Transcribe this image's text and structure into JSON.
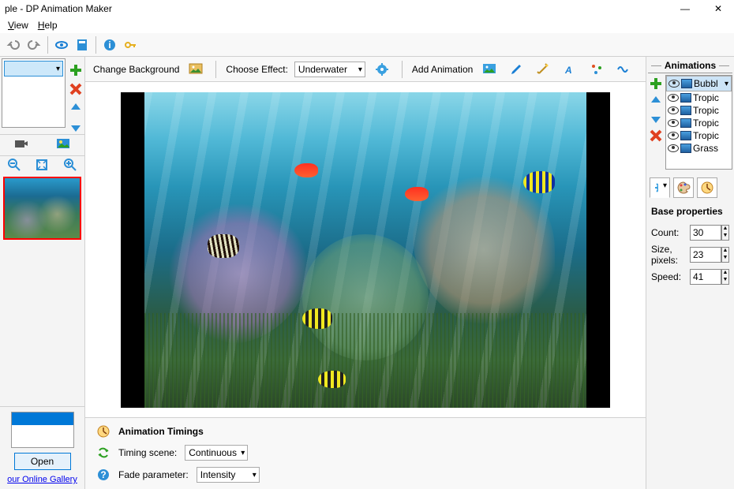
{
  "title": "ple - DP Animation Maker",
  "menu": {
    "view": "View",
    "help": "Help"
  },
  "toolbar2": {
    "change_bg": "Change Background",
    "choose_effect": "Choose Effect:",
    "effect_value": "Underwater",
    "add_animation": "Add Animation"
  },
  "left": {
    "open": "Open",
    "gallery": "our Online Gallery"
  },
  "timings": {
    "title": "Animation Timings",
    "scene_label": "Timing scene:",
    "scene_value": "Continuous",
    "fade_label": "Fade parameter:",
    "fade_value": "Intensity"
  },
  "anims": {
    "header": "Animations",
    "items": [
      {
        "label": "Bubbl"
      },
      {
        "label": "Tropic"
      },
      {
        "label": "Tropic"
      },
      {
        "label": "Tropic"
      },
      {
        "label": "Tropic"
      },
      {
        "label": "Grass"
      }
    ]
  },
  "props": {
    "title": "Base properties",
    "count_label": "Count:",
    "count": "30",
    "size_label": "Size, pixels:",
    "size": "23",
    "speed_label": "Speed:",
    "speed": "41"
  }
}
